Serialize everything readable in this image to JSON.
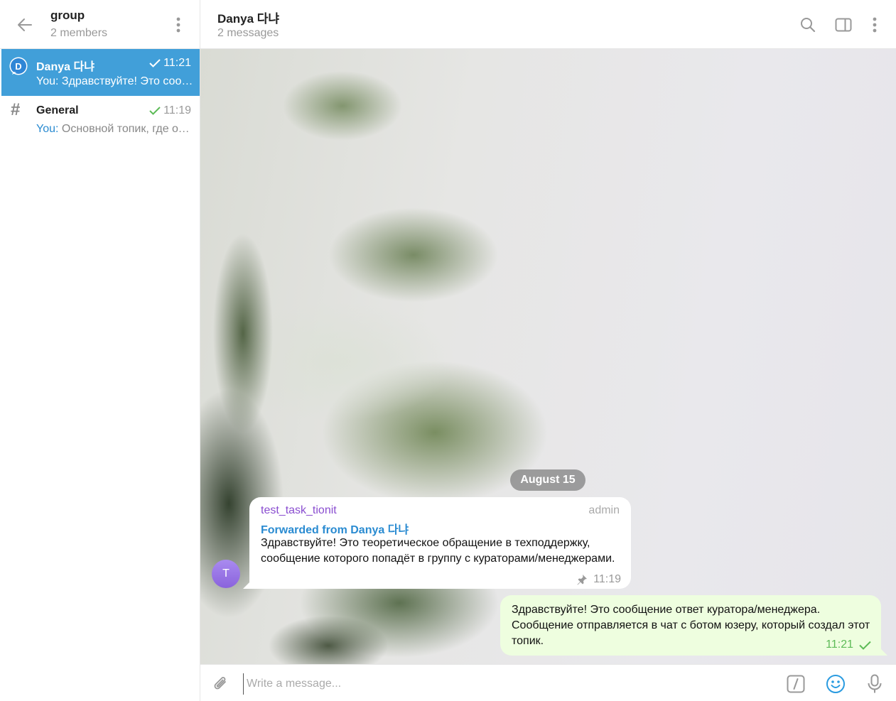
{
  "sidebar": {
    "title": "group",
    "subtitle": "2 members",
    "back_icon": "arrow-left-icon",
    "menu_icon": "more-vertical-icon",
    "chats": [
      {
        "avatar_letter": "D",
        "name": "Danya 다냐",
        "time": "11:21",
        "you": "You:",
        "preview": " Здравствуйте! Это сообщение ответ куратора/менеджера.",
        "status": "sent"
      },
      {
        "icon": "#",
        "name": "General",
        "time": "11:19",
        "you": "You:",
        "preview": " Основной топик, где отображаются все сообщения",
        "status": "read"
      }
    ]
  },
  "header": {
    "title": "Danya 다냐",
    "subtitle": "2 messages",
    "icons": [
      "search-icon",
      "sidebar-toggle-icon",
      "more-vertical-icon"
    ]
  },
  "chat": {
    "date": "August 15",
    "incoming": {
      "avatar_letter": "T",
      "sender": "test_task_tionit",
      "role": "admin",
      "forwarded": "Forwarded from Danya 다냐",
      "text": "Здравствуйте! Это теоретическое обращение в техподдержку, сообщение которого попадёт в группу с кураторами/менеджерами.",
      "time": "11:19"
    },
    "outgoing": {
      "text": "Здравствуйте! Это сообщение ответ куратора/менеджера. Сообщение отправляется в чат с ботом юзеру, который создал этот топик.",
      "time": "11:21"
    }
  },
  "composer": {
    "placeholder": "Write a message...",
    "icons": [
      "paperclip-icon",
      "bot-commands-icon",
      "emoji-icon",
      "microphone-icon"
    ]
  },
  "colors": {
    "accent": "#419fd9",
    "sender_name": "#8a4ed0",
    "forward_link": "#2a8bd1",
    "outgoing_bubble": "#eefedf",
    "read_check": "#5dbb57"
  }
}
